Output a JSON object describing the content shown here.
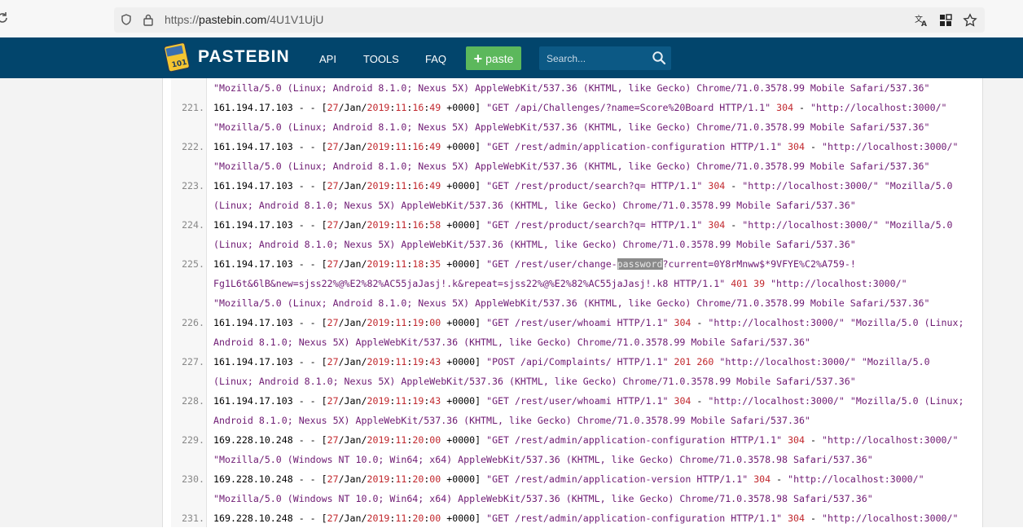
{
  "browser": {
    "url_scheme": "https://",
    "url_host": "pastebin.com",
    "url_path": "/4U1V1UjU"
  },
  "header": {
    "brand": "PASTEBIN",
    "nav": [
      "API",
      "TOOLS",
      "FAQ"
    ],
    "paste_label": "paste",
    "search_placeholder": "Search...",
    "colors": {
      "bar": "#02456c",
      "paste": "#5cb85c"
    }
  },
  "code": {
    "lines": [
      {
        "num": "",
        "segs": [
          [
            "s",
            "\"Mozilla/5.0 (Linux; Android 8.1.0; Nexus 5X) AppleWebKit/537.36 (KHTML, like Gecko) Chrome/71.0.3578.99 Mobile Safari/537.36\""
          ]
        ]
      },
      {
        "num": "221.",
        "segs": [
          [
            "k",
            "161.194.17.103 - - ["
          ],
          [
            "r",
            "27"
          ],
          [
            "k",
            "/Jan/"
          ],
          [
            "r",
            "2019"
          ],
          [
            "k",
            ":"
          ],
          [
            "r",
            "11"
          ],
          [
            "k",
            ":"
          ],
          [
            "r",
            "16"
          ],
          [
            "k",
            ":"
          ],
          [
            "r",
            "49"
          ],
          [
            "k",
            " +0000] "
          ],
          [
            "s",
            "\"GET /api/Challenges/?name=Score%20Board HTTP/1.1\""
          ],
          [
            "k",
            " "
          ],
          [
            "r",
            "304"
          ],
          [
            "k",
            " - "
          ],
          [
            "s",
            "\"http://localhost:3000/\""
          ]
        ]
      },
      {
        "num": "",
        "segs": [
          [
            "s",
            "\"Mozilla/5.0 (Linux; Android 8.1.0; Nexus 5X) AppleWebKit/537.36 (KHTML, like Gecko) Chrome/71.0.3578.99 Mobile Safari/537.36\""
          ]
        ]
      },
      {
        "num": "222.",
        "segs": [
          [
            "k",
            "161.194.17.103 - - ["
          ],
          [
            "r",
            "27"
          ],
          [
            "k",
            "/Jan/"
          ],
          [
            "r",
            "2019"
          ],
          [
            "k",
            ":"
          ],
          [
            "r",
            "11"
          ],
          [
            "k",
            ":"
          ],
          [
            "r",
            "16"
          ],
          [
            "k",
            ":"
          ],
          [
            "r",
            "49"
          ],
          [
            "k",
            " +0000] "
          ],
          [
            "s",
            "\"GET /rest/admin/application-configuration HTTP/1.1\""
          ],
          [
            "k",
            " "
          ],
          [
            "r",
            "304"
          ],
          [
            "k",
            " - "
          ],
          [
            "s",
            "\"http://localhost:3000/\""
          ]
        ]
      },
      {
        "num": "",
        "segs": [
          [
            "s",
            "\"Mozilla/5.0 (Linux; Android 8.1.0; Nexus 5X) AppleWebKit/537.36 (KHTML, like Gecko) Chrome/71.0.3578.99 Mobile Safari/537.36\""
          ]
        ]
      },
      {
        "num": "223.",
        "segs": [
          [
            "k",
            "161.194.17.103 - - ["
          ],
          [
            "r",
            "27"
          ],
          [
            "k",
            "/Jan/"
          ],
          [
            "r",
            "2019"
          ],
          [
            "k",
            ":"
          ],
          [
            "r",
            "11"
          ],
          [
            "k",
            ":"
          ],
          [
            "r",
            "16"
          ],
          [
            "k",
            ":"
          ],
          [
            "r",
            "49"
          ],
          [
            "k",
            " +0000] "
          ],
          [
            "s",
            "\"GET /rest/product/search?q= HTTP/1.1\""
          ],
          [
            "k",
            " "
          ],
          [
            "r",
            "304"
          ],
          [
            "k",
            " - "
          ],
          [
            "s",
            "\"http://localhost:3000/\" \"Mozilla/5.0"
          ]
        ]
      },
      {
        "num": "",
        "segs": [
          [
            "s",
            "(Linux; Android 8.1.0; Nexus 5X) AppleWebKit/537.36 (KHTML, like Gecko) Chrome/71.0.3578.99 Mobile Safari/537.36\""
          ]
        ]
      },
      {
        "num": "224.",
        "segs": [
          [
            "k",
            "161.194.17.103 - - ["
          ],
          [
            "r",
            "27"
          ],
          [
            "k",
            "/Jan/"
          ],
          [
            "r",
            "2019"
          ],
          [
            "k",
            ":"
          ],
          [
            "r",
            "11"
          ],
          [
            "k",
            ":"
          ],
          [
            "r",
            "16"
          ],
          [
            "k",
            ":"
          ],
          [
            "r",
            "58"
          ],
          [
            "k",
            " +0000] "
          ],
          [
            "s",
            "\"GET /rest/product/search?q= HTTP/1.1\""
          ],
          [
            "k",
            " "
          ],
          [
            "r",
            "304"
          ],
          [
            "k",
            " - "
          ],
          [
            "s",
            "\"http://localhost:3000/\" \"Mozilla/5.0"
          ]
        ]
      },
      {
        "num": "",
        "segs": [
          [
            "s",
            "(Linux; Android 8.1.0; Nexus 5X) AppleWebKit/537.36 (KHTML, like Gecko) Chrome/71.0.3578.99 Mobile Safari/537.36\""
          ]
        ]
      },
      {
        "num": "225.",
        "segs": [
          [
            "k",
            "161.194.17.103 - - ["
          ],
          [
            "r",
            "27"
          ],
          [
            "k",
            "/Jan/"
          ],
          [
            "r",
            "2019"
          ],
          [
            "k",
            ":"
          ],
          [
            "r",
            "11"
          ],
          [
            "k",
            ":"
          ],
          [
            "r",
            "18"
          ],
          [
            "k",
            ":"
          ],
          [
            "r",
            "35"
          ],
          [
            "k",
            " +0000] "
          ],
          [
            "s",
            "\"GET /rest/user/change-"
          ],
          [
            "h",
            "password"
          ],
          [
            "s",
            "?current=0Y8rMnww$*9VFYE%C2%A759-!"
          ]
        ]
      },
      {
        "num": "",
        "segs": [
          [
            "s",
            "Fg1L6t&6lB&new=sjss22%@%E2%82%AC55jaJasj!.k&repeat=sjss22%@%E2%82%AC55jaJasj!.k8 HTTP/1.1\""
          ],
          [
            "k",
            " "
          ],
          [
            "r",
            "401"
          ],
          [
            "k",
            " "
          ],
          [
            "r",
            "39"
          ],
          [
            "k",
            " "
          ],
          [
            "s",
            "\"http://localhost:3000/\""
          ]
        ]
      },
      {
        "num": "",
        "segs": [
          [
            "s",
            "\"Mozilla/5.0 (Linux; Android 8.1.0; Nexus 5X) AppleWebKit/537.36 (KHTML, like Gecko) Chrome/71.0.3578.99 Mobile Safari/537.36\""
          ]
        ]
      },
      {
        "num": "226.",
        "segs": [
          [
            "k",
            "161.194.17.103 - - ["
          ],
          [
            "r",
            "27"
          ],
          [
            "k",
            "/Jan/"
          ],
          [
            "r",
            "2019"
          ],
          [
            "k",
            ":"
          ],
          [
            "r",
            "11"
          ],
          [
            "k",
            ":"
          ],
          [
            "r",
            "19"
          ],
          [
            "k",
            ":"
          ],
          [
            "r",
            "00"
          ],
          [
            "k",
            " +0000] "
          ],
          [
            "s",
            "\"GET /rest/user/whoami HTTP/1.1\""
          ],
          [
            "k",
            " "
          ],
          [
            "r",
            "304"
          ],
          [
            "k",
            " - "
          ],
          [
            "s",
            "\"http://localhost:3000/\" \"Mozilla/5.0 (Linux;"
          ]
        ]
      },
      {
        "num": "",
        "segs": [
          [
            "s",
            "Android 8.1.0; Nexus 5X) AppleWebKit/537.36 (KHTML, like Gecko) Chrome/71.0.3578.99 Mobile Safari/537.36\""
          ]
        ]
      },
      {
        "num": "227.",
        "segs": [
          [
            "k",
            "161.194.17.103 - - ["
          ],
          [
            "r",
            "27"
          ],
          [
            "k",
            "/Jan/"
          ],
          [
            "r",
            "2019"
          ],
          [
            "k",
            ":"
          ],
          [
            "r",
            "11"
          ],
          [
            "k",
            ":"
          ],
          [
            "r",
            "19"
          ],
          [
            "k",
            ":"
          ],
          [
            "r",
            "43"
          ],
          [
            "k",
            " +0000] "
          ],
          [
            "s",
            "\"POST /api/Complaints/ HTTP/1.1\""
          ],
          [
            "k",
            " "
          ],
          [
            "r",
            "201"
          ],
          [
            "k",
            " "
          ],
          [
            "r",
            "260"
          ],
          [
            "k",
            " "
          ],
          [
            "s",
            "\"http://localhost:3000/\" \"Mozilla/5.0"
          ]
        ]
      },
      {
        "num": "",
        "segs": [
          [
            "s",
            "(Linux; Android 8.1.0; Nexus 5X) AppleWebKit/537.36 (KHTML, like Gecko) Chrome/71.0.3578.99 Mobile Safari/537.36\""
          ]
        ]
      },
      {
        "num": "228.",
        "segs": [
          [
            "k",
            "161.194.17.103 - - ["
          ],
          [
            "r",
            "27"
          ],
          [
            "k",
            "/Jan/"
          ],
          [
            "r",
            "2019"
          ],
          [
            "k",
            ":"
          ],
          [
            "r",
            "11"
          ],
          [
            "k",
            ":"
          ],
          [
            "r",
            "19"
          ],
          [
            "k",
            ":"
          ],
          [
            "r",
            "43"
          ],
          [
            "k",
            " +0000] "
          ],
          [
            "s",
            "\"GET /rest/user/whoami HTTP/1.1\""
          ],
          [
            "k",
            " "
          ],
          [
            "r",
            "304"
          ],
          [
            "k",
            " - "
          ],
          [
            "s",
            "\"http://localhost:3000/\" \"Mozilla/5.0 (Linux;"
          ]
        ]
      },
      {
        "num": "",
        "segs": [
          [
            "s",
            "Android 8.1.0; Nexus 5X) AppleWebKit/537.36 (KHTML, like Gecko) Chrome/71.0.3578.99 Mobile Safari/537.36\""
          ]
        ]
      },
      {
        "num": "229.",
        "segs": [
          [
            "k",
            "169.228.10.248 - - ["
          ],
          [
            "r",
            "27"
          ],
          [
            "k",
            "/Jan/"
          ],
          [
            "r",
            "2019"
          ],
          [
            "k",
            ":"
          ],
          [
            "r",
            "11"
          ],
          [
            "k",
            ":"
          ],
          [
            "r",
            "20"
          ],
          [
            "k",
            ":"
          ],
          [
            "r",
            "00"
          ],
          [
            "k",
            " +0000] "
          ],
          [
            "s",
            "\"GET /rest/admin/application-configuration HTTP/1.1\""
          ],
          [
            "k",
            " "
          ],
          [
            "r",
            "304"
          ],
          [
            "k",
            " - "
          ],
          [
            "s",
            "\"http://localhost:3000/\""
          ]
        ]
      },
      {
        "num": "",
        "segs": [
          [
            "s",
            "\"Mozilla/5.0 (Windows NT 10.0; Win64; x64) AppleWebKit/537.36 (KHTML, like Gecko) Chrome/71.0.3578.98 Safari/537.36\""
          ]
        ]
      },
      {
        "num": "230.",
        "segs": [
          [
            "k",
            "169.228.10.248 - - ["
          ],
          [
            "r",
            "27"
          ],
          [
            "k",
            "/Jan/"
          ],
          [
            "r",
            "2019"
          ],
          [
            "k",
            ":"
          ],
          [
            "r",
            "11"
          ],
          [
            "k",
            ":"
          ],
          [
            "r",
            "20"
          ],
          [
            "k",
            ":"
          ],
          [
            "r",
            "00"
          ],
          [
            "k",
            " +0000] "
          ],
          [
            "s",
            "\"GET /rest/admin/application-version HTTP/1.1\""
          ],
          [
            "k",
            " "
          ],
          [
            "r",
            "304"
          ],
          [
            "k",
            " - "
          ],
          [
            "s",
            "\"http://localhost:3000/\""
          ]
        ]
      },
      {
        "num": "",
        "segs": [
          [
            "s",
            "\"Mozilla/5.0 (Windows NT 10.0; Win64; x64) AppleWebKit/537.36 (KHTML, like Gecko) Chrome/71.0.3578.98 Safari/537.36\""
          ]
        ]
      },
      {
        "num": "231.",
        "segs": [
          [
            "k",
            "169.228.10.248 - - ["
          ],
          [
            "r",
            "27"
          ],
          [
            "k",
            "/Jan/"
          ],
          [
            "r",
            "2019"
          ],
          [
            "k",
            ":"
          ],
          [
            "r",
            "11"
          ],
          [
            "k",
            ":"
          ],
          [
            "r",
            "20"
          ],
          [
            "k",
            ":"
          ],
          [
            "r",
            "00"
          ],
          [
            "k",
            " +0000] "
          ],
          [
            "s",
            "\"GET /rest/admin/application-configuration HTTP/1.1\""
          ],
          [
            "k",
            " "
          ],
          [
            "r",
            "304"
          ],
          [
            "k",
            " - "
          ],
          [
            "s",
            "\"http://localhost:3000/\""
          ]
        ]
      }
    ]
  }
}
